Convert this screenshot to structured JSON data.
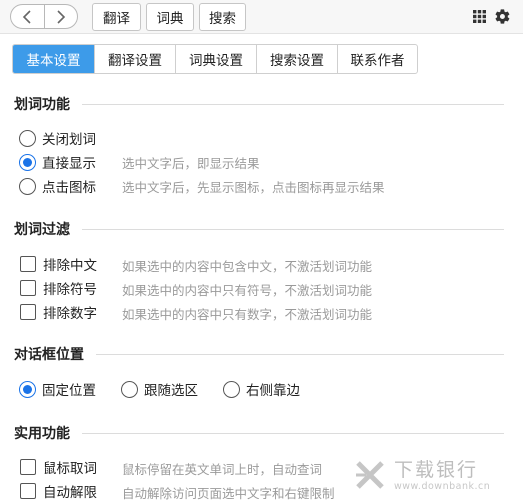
{
  "top_tabs": [
    "翻译",
    "词典",
    "搜索"
  ],
  "sub_tabs": [
    {
      "label": "基本设置",
      "active": true
    },
    {
      "label": "翻译设置",
      "active": false
    },
    {
      "label": "词典设置",
      "active": false
    },
    {
      "label": "搜索设置",
      "active": false
    },
    {
      "label": "联系作者",
      "active": false
    }
  ],
  "sections": {
    "word_selection": {
      "title": "划词功能",
      "options": [
        {
          "label": "关闭划词",
          "desc": "",
          "selected": false
        },
        {
          "label": "直接显示",
          "desc": "选中文字后，即显示结果",
          "selected": true
        },
        {
          "label": "点击图标",
          "desc": "选中文字后，先显示图标，点击图标再显示结果",
          "selected": false
        }
      ]
    },
    "filter": {
      "title": "划词过滤",
      "options": [
        {
          "label": "排除中文",
          "desc": "如果选中的内容中包含中文，不激活划词功能",
          "checked": false
        },
        {
          "label": "排除符号",
          "desc": "如果选中的内容中只有符号，不激活划词功能",
          "checked": false
        },
        {
          "label": "排除数字",
          "desc": "如果选中的内容中只有数字，不激活划词功能",
          "checked": false
        }
      ]
    },
    "dialog_position": {
      "title": "对话框位置",
      "options": [
        {
          "label": "固定位置",
          "selected": true
        },
        {
          "label": "跟随选区",
          "selected": false
        },
        {
          "label": "右侧靠边",
          "selected": false
        }
      ]
    },
    "utility": {
      "title": "实用功能",
      "options": [
        {
          "label": "鼠标取词",
          "desc": "鼠标停留在英文单词上时，自动查词",
          "checked": false
        },
        {
          "label": "自动解限",
          "desc": "自动解除访问页面选中文字和右键限制",
          "checked": false
        }
      ]
    }
  },
  "watermark": {
    "main": "下载银行",
    "sub": "www.downbank.cn"
  },
  "colors": {
    "accent": "#3d9be9",
    "radio_on": "#1a73e8"
  }
}
